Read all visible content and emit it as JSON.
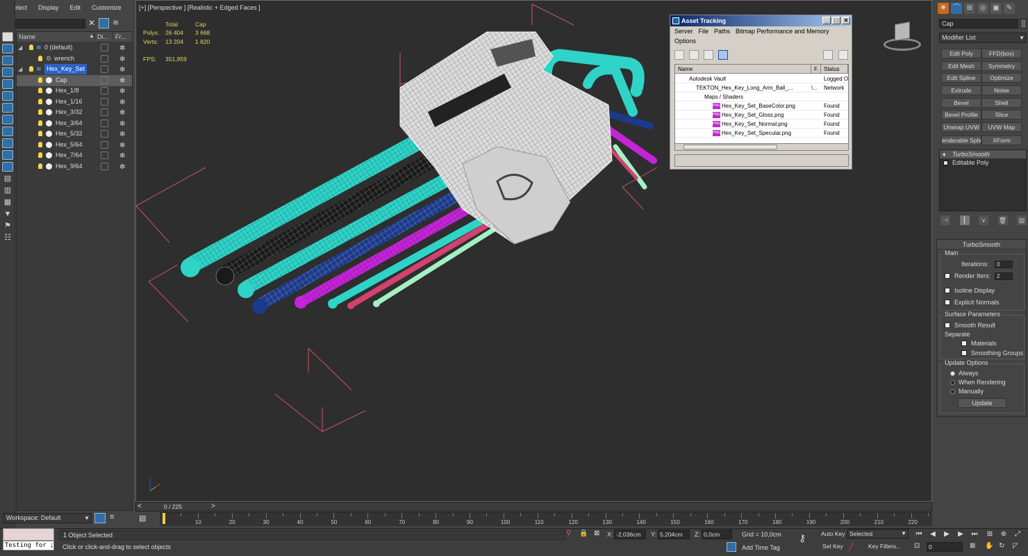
{
  "explorer": {
    "menu": [
      "Select",
      "Display",
      "Edit",
      "Customize"
    ],
    "columns": {
      "name": "Name",
      "display": "Di...",
      "frozen": "Fr..."
    },
    "rows": [
      {
        "label": "0 (default)"
      },
      {
        "label": "wrench"
      },
      {
        "label": "Hex_Key_Set"
      },
      {
        "label": "Cap"
      },
      {
        "label": "Hex_1/8"
      },
      {
        "label": "Hex_1/16"
      },
      {
        "label": "Hex_3/32"
      },
      {
        "label": "Hex_3/64"
      },
      {
        "label": "Hex_5/32"
      },
      {
        "label": "Hex_5/64"
      },
      {
        "label": "Hex_7/64"
      },
      {
        "label": "Hex_9/64"
      }
    ]
  },
  "viewport": {
    "label": "[+] [Perspective ] [Realistic + Edged Faces ]",
    "stats": {
      "col_total": "Total",
      "col_cap": "Cap",
      "polys_label": "Polys:",
      "polys_total": "26 404",
      "polys_cap": "3 668",
      "verts_label": "Verts:",
      "verts_total": "13 204",
      "verts_cap": "1 820",
      "fps_label": "FPS:",
      "fps_value": "351,959"
    },
    "colors": {
      "cyan": "#2fd3c8",
      "magenta": "#c424d8",
      "pink": "#d24270",
      "mint": "#a4f0c4",
      "dark": "#1b3a8a",
      "black": "#1a1a1a",
      "cap": "#dcdcdc"
    }
  },
  "asset_tracking": {
    "title": "Asset Tracking",
    "menu": [
      "Server",
      "File",
      "Paths",
      "Bitmap Performance and Memory"
    ],
    "menu2": "Options",
    "columns": {
      "name": "Name",
      "f": "F.",
      "status": "Status"
    },
    "rows": [
      {
        "name": "Autodesk Vault",
        "f": "",
        "status": "Logged O"
      },
      {
        "name": "TEKTON_Hex_Key_Long_Arm_Ball_...",
        "f": "\\...",
        "status": "Network"
      },
      {
        "name": "Maps / Shaders",
        "f": "",
        "status": ""
      },
      {
        "name": "Hex_Key_Set_BaseColor.png",
        "f": "",
        "status": "Found"
      },
      {
        "name": "Hex_Key_Set_Gloss.png",
        "f": "",
        "status": "Found"
      },
      {
        "name": "Hex_Key_Set_Normal.png",
        "f": "",
        "status": "Found"
      },
      {
        "name": "Hex_Key_Set_Specular.png",
        "f": "",
        "status": "Found"
      }
    ]
  },
  "command_panel": {
    "object_name": "Cap",
    "modifier_list": "Modifier List",
    "buttons": [
      "Edit Poly",
      "FFD(box)",
      "Edit Mesh",
      "Symmetry",
      "Edit Spline",
      "Optimize",
      "Extrude",
      "Noise",
      "Bevel",
      "Shell",
      "Bevel Profile",
      "Slice",
      "Unwrap UVW",
      "UVW Map",
      "enderable Splin",
      "XForm"
    ],
    "stack": [
      "TurboSmooth",
      "Editable Poly"
    ],
    "rollout": {
      "title": "TurboSmooth",
      "main": "Main",
      "iterations_label": "Iterations:",
      "iterations": "0",
      "render_iters_label": "Render Iters:",
      "render_iters": "2",
      "isoline": "Isoline Display",
      "explicit": "Explicit Normals",
      "surface": "Surface Parameters",
      "smooth_result": "Smooth Result",
      "separate": "Separate",
      "materials": "Materials",
      "smoothing_groups": "Smoothing Groups",
      "update_options": "Update Options",
      "always": "Always",
      "when_rendering": "When Rendering",
      "manually": "Manually",
      "update": "Update"
    }
  },
  "bottom": {
    "workspace": "Workspace: Default",
    "time_slider": "0 / 225",
    "timeline_ticks": [
      "10",
      "20",
      "30",
      "40",
      "50",
      "60",
      "70",
      "80",
      "90",
      "100",
      "110",
      "120",
      "130",
      "140",
      "150",
      "160",
      "170",
      "180",
      "190",
      "200",
      "210",
      "220"
    ],
    "maxscript": "Testing for ;",
    "selection_count": "1 Object Selected",
    "prompt": "Click or click-and-drag to select objects",
    "x_label": "X:",
    "x_value": "-2,036cm",
    "y_label": "Y:",
    "y_value": "5,204cm",
    "z_label": "Z:",
    "z_value": "0,0cm",
    "grid": "Grid = 10,0cm",
    "add_time_tag": "Add Time Tag",
    "auto_key": "Auto Key",
    "set_key": "Set Key",
    "selected": "Selected",
    "key_filters": "Key Filters...",
    "frame": "0"
  }
}
